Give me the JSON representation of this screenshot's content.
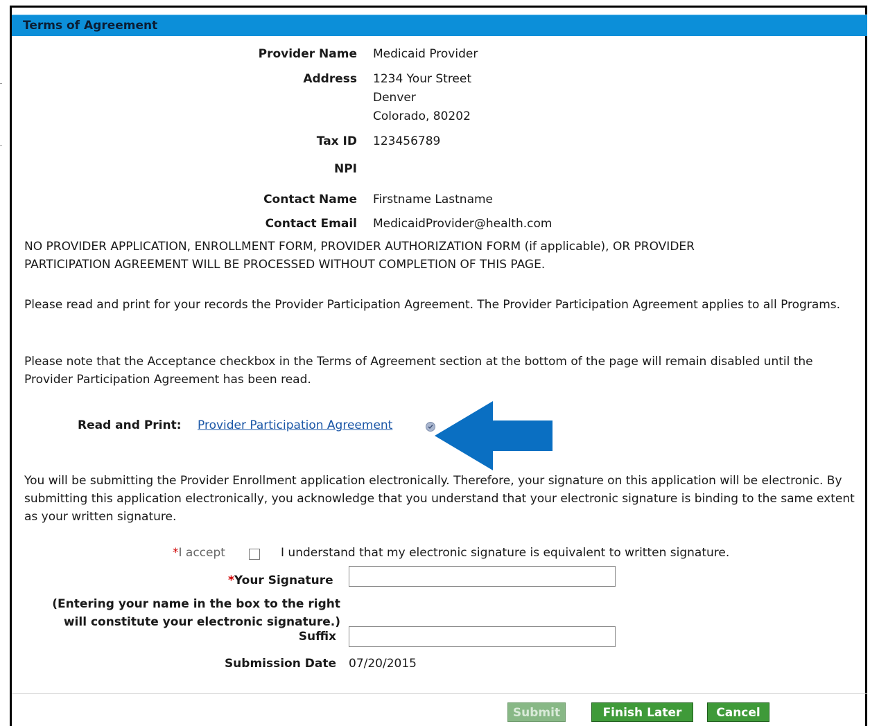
{
  "section_title": "Terms of Agreement",
  "provider": {
    "name_label": "Provider Name",
    "name": "Medicaid Provider",
    "address_label": "Address",
    "address_line1": "1234 Your Street",
    "address_line2": "Denver",
    "address_line3": "Colorado, 80202",
    "tax_id_label": "Tax ID",
    "tax_id": "123456789",
    "npi_label": "NPI",
    "npi": "",
    "contact_name_label": "Contact Name",
    "contact_name": "Firstname Lastname",
    "contact_email_label": "Contact Email",
    "contact_email": "MedicaidProvider@health.com"
  },
  "notices": {
    "warning": "NO PROVIDER APPLICATION, ENROLLMENT FORM, PROVIDER AUTHORIZATION FORM (if applicable), OR PROVIDER PARTICIPATION AGREEMENT WILL BE PROCESSED WITHOUT COMPLETION OF THIS PAGE.",
    "read_print": "Please read and print for your records the Provider Participation Agreement. The Provider Participation Agreement applies to all Programs.",
    "checkbox_note": "Please note that the Acceptance checkbox in the Terms of Agreement section at the bottom of the page will remain disabled until the Provider Participation Agreement has been read.",
    "electronic": "You will be submitting the Provider Enrollment application electronically. Therefore, your signature on this application will be electronic. By submitting this application electronically, you acknowledge that you understand that your electronic signature is binding to the same extent as your written signature."
  },
  "agreement": {
    "label": "Read and Print:",
    "link_text": "Provider Participation Agreement",
    "status_icon": "check-circle-icon",
    "arrow_color": "#0a6fc2"
  },
  "acceptance": {
    "required_mark": "*",
    "label": "I accept",
    "checked": false,
    "text": "I understand that my electronic signature is equivalent to written signature."
  },
  "signature": {
    "required_mark": "*",
    "label": "Your Signature",
    "value": "",
    "note": "(Entering your name in the box to the right will constitute your electronic signature.)",
    "suffix_label": "Suffix",
    "suffix_value": ""
  },
  "submission": {
    "date_label": "Submission Date",
    "date": "07/20/2015"
  },
  "buttons": {
    "submit": "Submit",
    "finish_later": "Finish Later",
    "cancel": "Cancel"
  },
  "colors": {
    "header": "#0c8fd9",
    "button": "#3f9a39",
    "link": "#1a56a6",
    "required": "#d00000"
  }
}
